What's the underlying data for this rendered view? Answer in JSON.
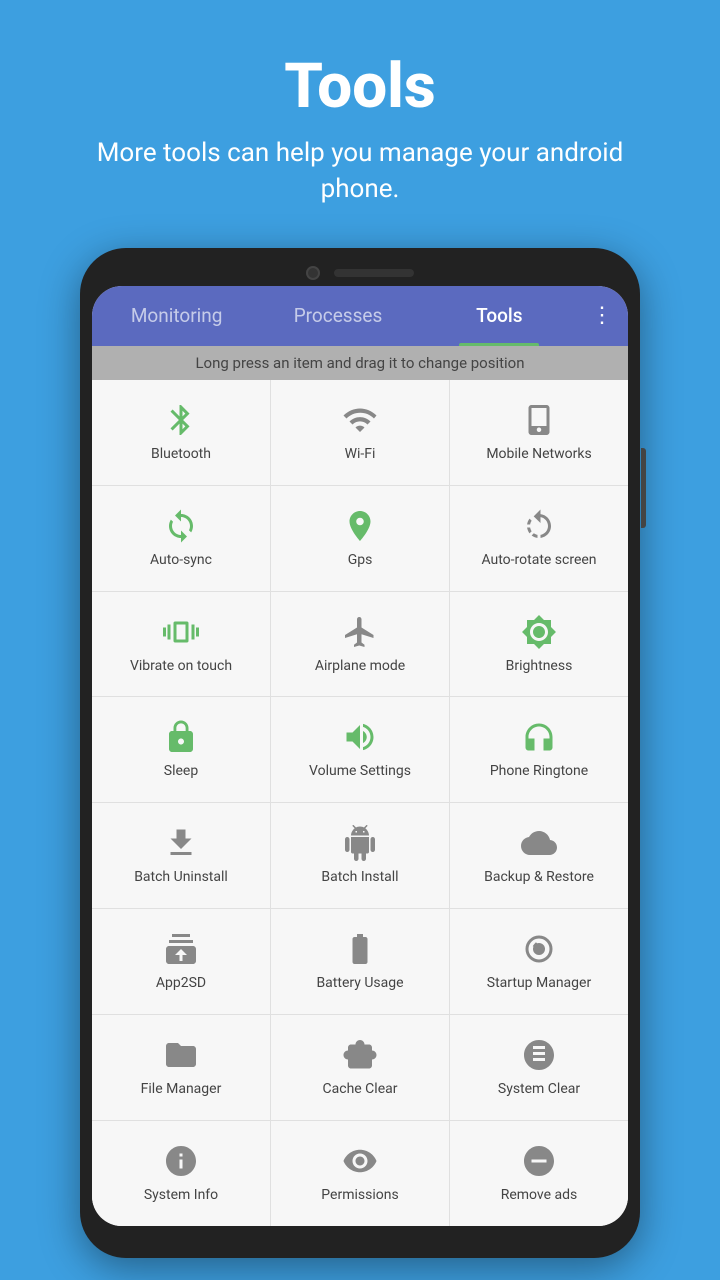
{
  "header": {
    "title": "Tools",
    "subtitle": "More tools can help you manage your android phone."
  },
  "tabs": [
    {
      "label": "Monitoring",
      "active": false
    },
    {
      "label": "Processes",
      "active": false
    },
    {
      "label": "Tools",
      "active": true
    }
  ],
  "menu_icon": "⋮",
  "hint": "Long press an item and drag it to change position",
  "tools": [
    {
      "label": "Bluetooth",
      "iconType": "green",
      "icon": "bluetooth"
    },
    {
      "label": "Wi-Fi",
      "iconType": "gray",
      "icon": "wifi"
    },
    {
      "label": "Mobile Networks",
      "iconType": "gray",
      "icon": "mobile-network"
    },
    {
      "label": "Auto-sync",
      "iconType": "green",
      "icon": "sync"
    },
    {
      "label": "Gps",
      "iconType": "green",
      "icon": "gps"
    },
    {
      "label": "Auto-rotate screen",
      "iconType": "gray",
      "icon": "rotate"
    },
    {
      "label": "Vibrate on touch",
      "iconType": "green",
      "icon": "vibrate"
    },
    {
      "label": "Airplane mode",
      "iconType": "gray",
      "icon": "airplane"
    },
    {
      "label": "Brightness",
      "iconType": "green",
      "icon": "brightness"
    },
    {
      "label": "Sleep",
      "iconType": "green",
      "icon": "lock"
    },
    {
      "label": "Volume Settings",
      "iconType": "green",
      "icon": "volume"
    },
    {
      "label": "Phone Ringtone",
      "iconType": "green",
      "icon": "ringtone"
    },
    {
      "label": "Batch Uninstall",
      "iconType": "gray",
      "icon": "uninstall"
    },
    {
      "label": "Batch Install",
      "iconType": "gray",
      "icon": "android"
    },
    {
      "label": "Backup & Restore",
      "iconType": "gray",
      "icon": "backup"
    },
    {
      "label": "App2SD",
      "iconType": "gray",
      "icon": "app2sd"
    },
    {
      "label": "Battery Usage",
      "iconType": "gray",
      "icon": "battery"
    },
    {
      "label": "Startup Manager",
      "iconType": "gray",
      "icon": "startup"
    },
    {
      "label": "File Manager",
      "iconType": "gray",
      "icon": "folder"
    },
    {
      "label": "Cache Clear",
      "iconType": "gray",
      "icon": "cache"
    },
    {
      "label": "System Clear",
      "iconType": "gray",
      "icon": "system-clear"
    },
    {
      "label": "System Info",
      "iconType": "gray",
      "icon": "info"
    },
    {
      "label": "Permissions",
      "iconType": "gray",
      "icon": "eye"
    },
    {
      "label": "Remove ads",
      "iconType": "gray",
      "icon": "remove-ads"
    }
  ]
}
